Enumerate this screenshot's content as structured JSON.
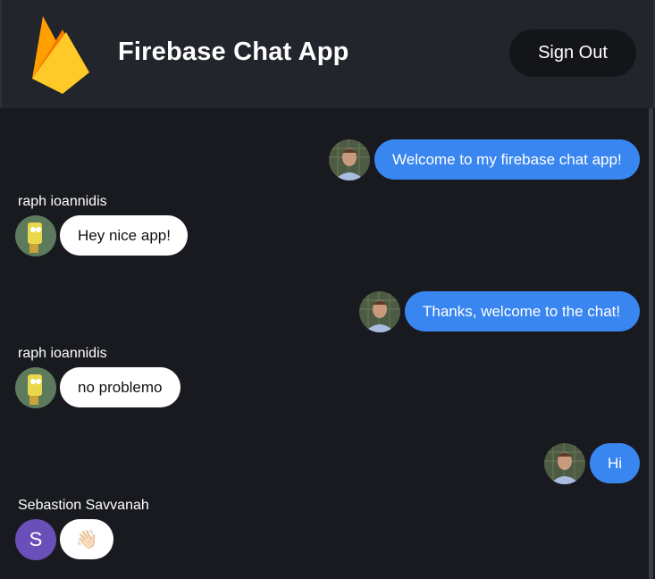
{
  "header": {
    "title": "Firebase Chat App",
    "sign_out_label": "Sign Out"
  },
  "messages": [
    {
      "type": "sent",
      "text": "Welcome to my firebase chat app!"
    },
    {
      "type": "received",
      "sender": "raph ioannidis",
      "text": "Hey nice app!"
    },
    {
      "type": "sent",
      "text": "Thanks, welcome to the chat!"
    },
    {
      "type": "received",
      "sender": "raph ioannidis",
      "text": "no problemo"
    },
    {
      "type": "sent",
      "text": "Hi"
    },
    {
      "type": "received",
      "sender": "Sebastion Savvanah",
      "avatar_letter": "S",
      "text": "👋🏻"
    }
  ],
  "colors": {
    "header_bg": "#22252b",
    "chat_bg": "#181a1f",
    "sent_bubble": "#3a86f0",
    "received_bubble": "#ffffff",
    "letter_avatar": "#6a4fb8"
  }
}
